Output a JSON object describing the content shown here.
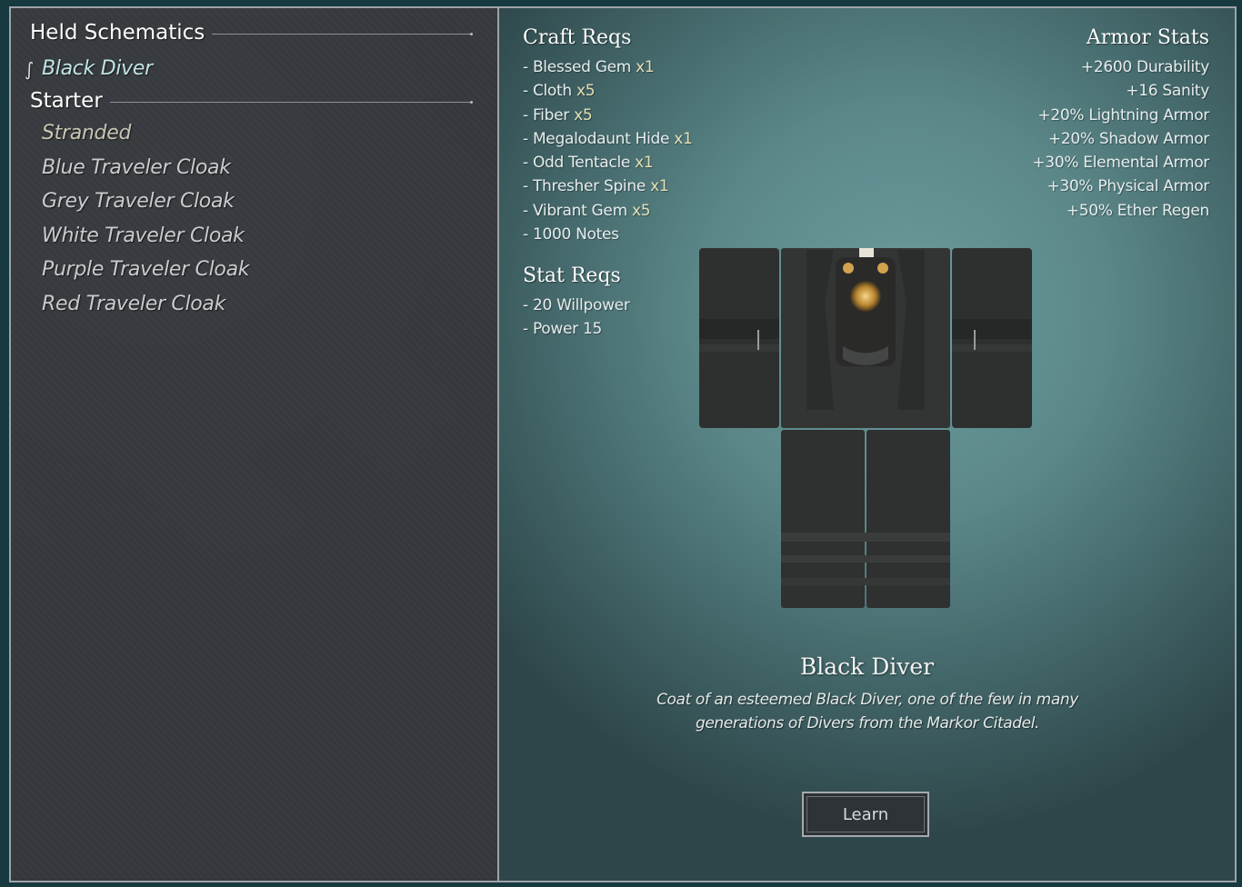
{
  "left_panel": {
    "held_header": "Held Schematics",
    "selected_item": {
      "marker_icon": "ornate-bracket-icon",
      "marker_glyph": "∫",
      "label": "Black Diver"
    },
    "starter_header": "Starter",
    "starter_items": [
      {
        "label": "Stranded"
      },
      {
        "label": "Blue Traveler Cloak"
      },
      {
        "label": "Grey Traveler Cloak"
      },
      {
        "label": "White Traveler Cloak"
      },
      {
        "label": "Purple Traveler Cloak"
      },
      {
        "label": "Red Traveler Cloak"
      }
    ]
  },
  "details": {
    "craft_reqs_title": "Craft Reqs",
    "craft_reqs": [
      {
        "name": "- Blessed Gem",
        "qty": "x1"
      },
      {
        "name": "- Cloth",
        "qty": "x5"
      },
      {
        "name": "- Fiber",
        "qty": "x5"
      },
      {
        "name": "- Megalodaunt Hide",
        "qty": "x1"
      },
      {
        "name": "- Odd Tentacle",
        "qty": "x1"
      },
      {
        "name": "- Thresher Spine",
        "qty": "x1"
      },
      {
        "name": "- Vibrant Gem",
        "qty": "x5"
      },
      {
        "name": "- 1000 Notes",
        "qty": ""
      }
    ],
    "stat_reqs_title": "Stat Reqs",
    "stat_reqs": [
      "- 20 Willpower",
      "- Power 15"
    ],
    "armor_stats_title": "Armor Stats",
    "armor_stats": [
      "+2600 Durability",
      "+16 Sanity",
      "+20% Lightning Armor",
      "+20% Shadow Armor",
      "+30% Elemental Armor",
      "+30% Physical Armor",
      "+50% Ether Regen"
    ],
    "item_name": "Black Diver",
    "item_description": "Coat of an esteemed Black Diver, one of the few in many generations of Divers from the Markor Citadel.",
    "learn_button": "Learn"
  },
  "colors": {
    "left_bg": "#35383c",
    "right_bg": "#5b8789",
    "selected_text": "#bfe4e6",
    "qty_text": "#e4dfb4",
    "border": "#9ea3a8"
  }
}
